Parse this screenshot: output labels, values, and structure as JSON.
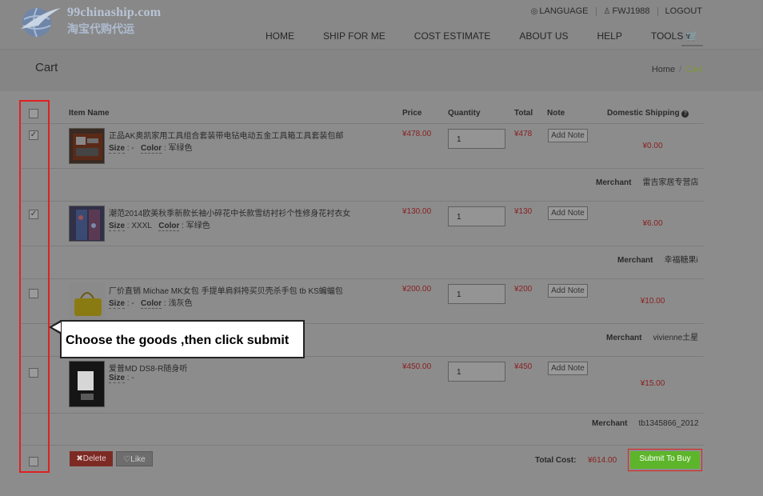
{
  "header": {
    "logo_text": "99chinaship.com",
    "logo_subtext": "淘宝代购代运",
    "top_links": [
      {
        "icon": "globe-icon",
        "label": "LANGUAGE"
      },
      {
        "icon": "user-icon",
        "label": "FWJ1988"
      },
      {
        "icon": "",
        "label": "LOGOUT"
      }
    ],
    "nav": [
      "HOME",
      "SHIP FOR ME",
      "COST ESTIMATE",
      "ABOUT US",
      "HELP",
      "TOOLS ▾"
    ],
    "cart_icon": "shopping-cart-icon"
  },
  "page": {
    "title": "Cart",
    "breadcrumb": {
      "home": "Home",
      "separator": "/",
      "current": "Cart"
    }
  },
  "table": {
    "columns": {
      "item_name": "Item Name",
      "price": "Price",
      "quantity": "Quantity",
      "total": "Total",
      "note": "Note",
      "domestic_shipping": "Domestic Shipping",
      "help_icon": "question-circle-icon"
    },
    "size_label": "Size",
    "color_label": "Color",
    "note_button": "Add Note",
    "merchant_label": "Merchant",
    "items": [
      {
        "checked": true,
        "name": "正品AK奥凯家用工具组合套装带电钻电动五金工具箱工具套装包邮",
        "size": " : -",
        "color": " : 军绿色",
        "price": "¥478.00",
        "quantity": "1",
        "total": "¥478",
        "shipping": "¥0.00",
        "merchant": "雷吉家居专营店"
      },
      {
        "checked": true,
        "name": "潮范2014欧美秋季新款长袖小碎花中长款雪纺衬衫个性修身花衬衣女",
        "size": " : XXXL",
        "color": " : 军绿色",
        "price": "¥130.00",
        "quantity": "1",
        "total": "¥130",
        "shipping": "¥6.00",
        "merchant": "幸福糖果i"
      },
      {
        "checked": false,
        "name": "厂价直销 Michae MK女包 手提单肩斜挎买贝壳杀手包 tb KS蝙蝠包",
        "size": " : -",
        "color": " : 浅灰色",
        "price": "¥200.00",
        "quantity": "1",
        "total": "¥200",
        "shipping": "¥10.00",
        "merchant": "vivienne土星"
      },
      {
        "checked": false,
        "name": "爱普MD DS8-R随身听",
        "size": " : -",
        "color": "",
        "price": "¥450.00",
        "quantity": "1",
        "total": "¥450",
        "shipping": "¥15.00",
        "merchant": "tb1345866_2012"
      }
    ]
  },
  "footer": {
    "delete_label": "Delete",
    "like_label": "Like",
    "total_cost_label": "Total Cost:",
    "total_cost_value": "¥614.00",
    "submit_label": "Submit To Buy"
  },
  "annotation": {
    "callout_text": "Choose the goods ,then click submit",
    "highlight_color": "#e02020"
  }
}
